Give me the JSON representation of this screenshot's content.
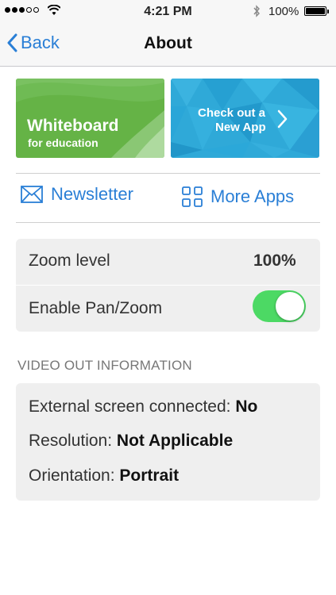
{
  "status_bar": {
    "time": "4:21 PM",
    "battery_text": "100%",
    "signal_bars_filled": 3,
    "signal_bars_total": 5,
    "icons": [
      "signal-dots",
      "wifi-icon",
      "bluetooth-icon",
      "battery-icon"
    ]
  },
  "nav": {
    "back_label": "Back",
    "title": "About"
  },
  "banners": {
    "whiteboard": {
      "title": "Whiteboard",
      "subtitle": "for education",
      "color": "#65b346"
    },
    "new_app": {
      "line1": "Check out a",
      "line2": "New App",
      "color": "#2fa9d8"
    }
  },
  "links": {
    "newsletter": "Newsletter",
    "more_apps": "More Apps"
  },
  "settings": {
    "zoom_label": "Zoom level",
    "zoom_value": "100%",
    "pan_zoom_label": "Enable Pan/Zoom",
    "pan_zoom_enabled": true
  },
  "video_out": {
    "header": "VIDEO OUT INFORMATION",
    "external_label": "External screen connected:",
    "external_value": "No",
    "resolution_label": "Resolution:",
    "resolution_value": "Not Applicable",
    "orientation_label": "Orientation:",
    "orientation_value": "Portrait"
  },
  "colors": {
    "accent": "#2a7fd6",
    "toggle_on": "#4cd964",
    "card_bg": "#efefef"
  }
}
